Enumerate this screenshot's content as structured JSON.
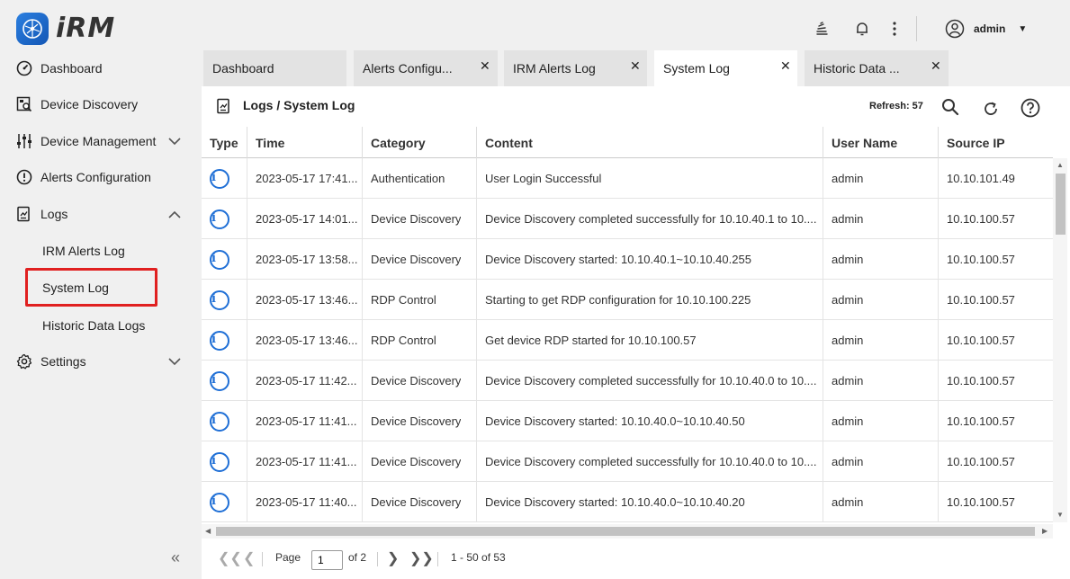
{
  "app": {
    "logo_text": "iRM"
  },
  "header": {
    "username": "admin",
    "icons": [
      "stack-icon",
      "bell-icon",
      "kebab-menu-icon",
      "user-avatar-icon",
      "caret-down-icon"
    ]
  },
  "sidebar": {
    "items": [
      {
        "label": "Dashboard",
        "icon": "dashboard-icon"
      },
      {
        "label": "Device Discovery",
        "icon": "device-discovery-icon"
      },
      {
        "label": "Device Management",
        "icon": "sliders-icon"
      },
      {
        "label": "Alerts Configuration",
        "icon": "alert-icon"
      },
      {
        "label": "Logs",
        "icon": "logs-icon"
      },
      {
        "label": "Settings",
        "icon": "gear-icon"
      }
    ],
    "logs_sub": [
      {
        "label": "IRM Alerts Log"
      },
      {
        "label": "System Log"
      },
      {
        "label": "Historic Data Logs"
      }
    ],
    "collapse_label": "«"
  },
  "tabs": [
    {
      "label": "Dashboard",
      "closable": false
    },
    {
      "label": "Alerts Configu...",
      "closable": true
    },
    {
      "label": "IRM Alerts Log",
      "closable": true
    },
    {
      "label": "System Log",
      "closable": true,
      "active": true
    },
    {
      "label": "Historic Data ...",
      "closable": true
    }
  ],
  "panel": {
    "breadcrumb": "Logs / System Log",
    "refresh": "Refresh: 57"
  },
  "table": {
    "columns": [
      "Type",
      "Time",
      "Category",
      "Content",
      "User Name",
      "Source IP"
    ],
    "rows": [
      {
        "time": "2023-05-17 17:41...",
        "category": "Authentication",
        "content": "User Login Successful",
        "user": "admin",
        "ip": "10.10.101.49"
      },
      {
        "time": "2023-05-17 14:01...",
        "category": "Device Discovery",
        "content": "Device Discovery completed successfully for 10.10.40.1 to 10....",
        "user": "admin",
        "ip": "10.10.100.57"
      },
      {
        "time": "2023-05-17 13:58...",
        "category": "Device Discovery",
        "content": "Device Discovery started: 10.10.40.1~10.10.40.255",
        "user": "admin",
        "ip": "10.10.100.57"
      },
      {
        "time": "2023-05-17 13:46...",
        "category": "RDP Control",
        "content": "Starting to get RDP configuration for 10.10.100.225",
        "user": "admin",
        "ip": "10.10.100.57"
      },
      {
        "time": "2023-05-17 13:46...",
        "category": "RDP Control",
        "content": "Get device RDP started for 10.10.100.57",
        "user": "admin",
        "ip": "10.10.100.57"
      },
      {
        "time": "2023-05-17 11:42...",
        "category": "Device Discovery",
        "content": "Device Discovery completed successfully for 10.10.40.0 to 10....",
        "user": "admin",
        "ip": "10.10.100.57"
      },
      {
        "time": "2023-05-17 11:41...",
        "category": "Device Discovery",
        "content": "Device Discovery started: 10.10.40.0~10.10.40.50",
        "user": "admin",
        "ip": "10.10.100.57"
      },
      {
        "time": "2023-05-17 11:41...",
        "category": "Device Discovery",
        "content": "Device Discovery completed successfully for 10.10.40.0 to 10....",
        "user": "admin",
        "ip": "10.10.100.57"
      },
      {
        "time": "2023-05-17 11:40...",
        "category": "Device Discovery",
        "content": "Device Discovery started: 10.10.40.0~10.10.40.20",
        "user": "admin",
        "ip": "10.10.100.57"
      }
    ]
  },
  "pager": {
    "page_label": "Page",
    "page_value": "1",
    "of_label": "of 2",
    "range": "1 - 50 of 53"
  },
  "colors": {
    "accent": "#1f6fd6",
    "highlight": "#e02020"
  }
}
